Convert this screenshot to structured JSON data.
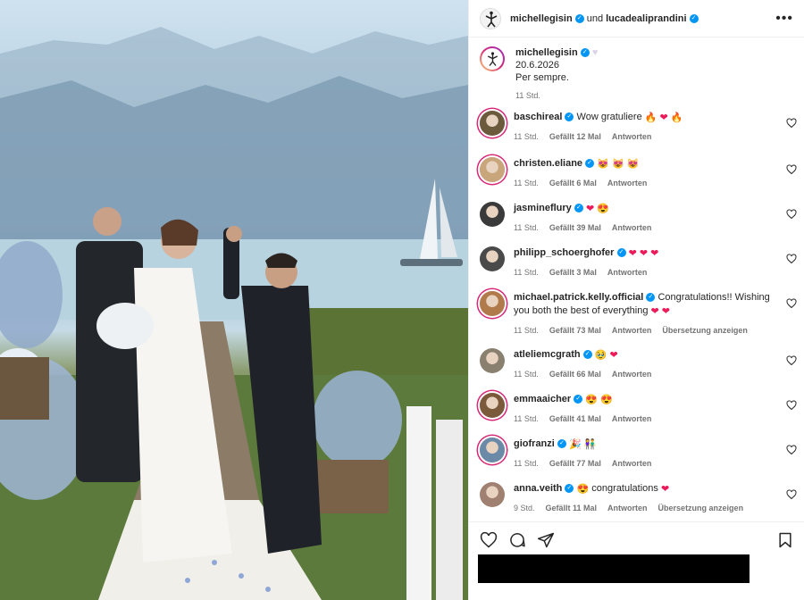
{
  "header": {
    "user1": "michellegisin",
    "connector": "und",
    "user2": "lucadealiprandini",
    "more_label": "•••"
  },
  "caption": {
    "username": "michellegisin",
    "line1": "20.6.2026",
    "line2": "Per sempre.",
    "time": "11 Std."
  },
  "comments": [
    {
      "username": "baschireal",
      "text": "Wow gratuliere",
      "emojis": [
        "fire",
        "heart",
        "fire"
      ],
      "time": "11 Std.",
      "likes": "Gefällt 12 Mal",
      "reply": "Antworten",
      "extra": "",
      "avatar_color": "#6b5a3c"
    },
    {
      "username": "christen.eliane",
      "text": "",
      "emojis": [
        "cat",
        "cat",
        "cat"
      ],
      "time": "11 Std.",
      "likes": "Gefällt 6 Mal",
      "reply": "Antworten",
      "extra": "",
      "avatar_color": "#c8a57a"
    },
    {
      "username": "jasmineflury",
      "text": "",
      "emojis": [
        "heart",
        "hearteyes"
      ],
      "time": "11 Std.",
      "likes": "Gefällt 39 Mal",
      "reply": "Antworten",
      "extra": "",
      "avatar_color": "#3a3a3a"
    },
    {
      "username": "philipp_schoerghofer",
      "text": "",
      "emojis": [
        "heart",
        "heart",
        "heart"
      ],
      "time": "11 Std.",
      "likes": "Gefällt 3 Mal",
      "reply": "Antworten",
      "extra": "",
      "avatar_color": "#4a4a4a"
    },
    {
      "username": "michael.patrick.kelly.official",
      "text": "Congratulations!! Wishing you both the best of everything",
      "emojis": [
        "heart",
        "heart"
      ],
      "time": "11 Std.",
      "likes": "Gefällt 73 Mal",
      "reply": "Antworten",
      "extra": "Übersetzung anzeigen",
      "avatar_color": "#b07a4a"
    },
    {
      "username": "atleliemcgrath",
      "text": "",
      "emojis": [
        "tear",
        "heart"
      ],
      "time": "11 Std.",
      "likes": "Gefällt 66 Mal",
      "reply": "Antworten",
      "extra": "",
      "avatar_color": "#8a8070"
    },
    {
      "username": "emmaaicher",
      "text": "",
      "emojis": [
        "hearteyes",
        "hearteyes"
      ],
      "time": "11 Std.",
      "likes": "Gefällt 41 Mal",
      "reply": "Antworten",
      "extra": "",
      "avatar_color": "#7a5a3a"
    },
    {
      "username": "giofranzi",
      "text": "",
      "emojis": [
        "party",
        "couple"
      ],
      "time": "11 Std.",
      "likes": "Gefällt 77 Mal",
      "reply": "Antworten",
      "extra": "",
      "avatar_color": "#6a8aa8"
    },
    {
      "username": "anna.veith",
      "text": "congratulations",
      "emojis": [
        "hearteyes"
      ],
      "trailing": [
        "heart"
      ],
      "time": "9 Std.",
      "likes": "Gefällt 11 Mal",
      "reply": "Antworten",
      "extra": "Übersetzung anzeigen",
      "avatar_color": "#a08070"
    }
  ],
  "actions": {
    "like_icon": "heart-outline-icon",
    "comment_icon": "comment-icon",
    "share_icon": "share-icon",
    "save_icon": "bookmark-icon"
  },
  "colors": {
    "verified": "#0095f6",
    "heart": "#ed1a5a",
    "muted": "#737373"
  }
}
